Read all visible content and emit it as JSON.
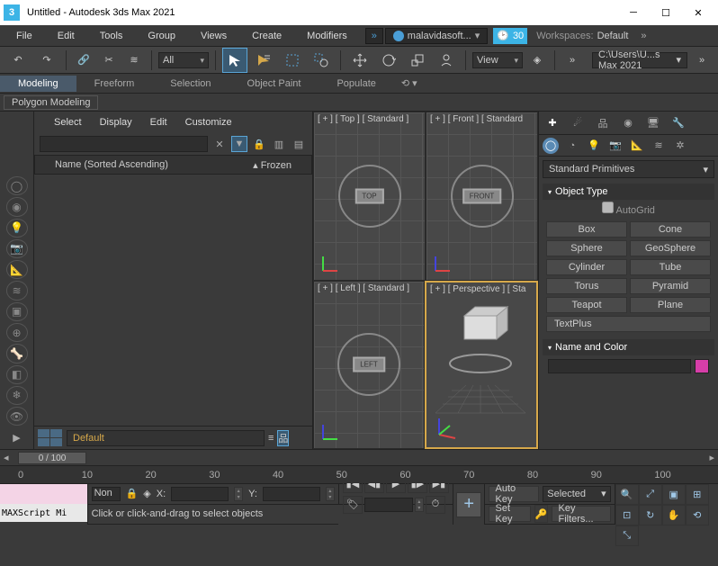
{
  "window": {
    "title": "Untitled - Autodesk 3ds Max 2021",
    "logo_text": "3"
  },
  "menu": {
    "items": [
      "File",
      "Edit",
      "Tools",
      "Group",
      "Views",
      "Create",
      "Modifiers"
    ],
    "signin": "malavidasoft...",
    "clock": "30",
    "workspaces_label": "Workspaces:",
    "workspaces_value": "Default"
  },
  "toolbar": {
    "selection_filter": "All",
    "view": "View",
    "path": "C:\\Users\\U...s Max 2021"
  },
  "ribbon": {
    "tabs": [
      "Modeling",
      "Freeform",
      "Selection",
      "Object Paint",
      "Populate"
    ],
    "sub": "Polygon Modeling"
  },
  "outliner": {
    "menu": [
      "Select",
      "Display",
      "Edit",
      "Customize"
    ],
    "header_name": "Name (Sorted Ascending)",
    "header_frozen": "▴ Frozen"
  },
  "viewports": {
    "top": {
      "label": "[ + ] [ Top ] [ Standard ]",
      "badge": "TOP"
    },
    "front": {
      "label": "[ + ] [ Front ] [ Standard",
      "badge": "FRONT"
    },
    "left": {
      "label": "[ + ] [ Left ] [ Standard ]",
      "badge": "LEFT"
    },
    "persp": {
      "label": "[ + ] [ Perspective ] [ Sta"
    }
  },
  "cmd": {
    "category": "Standard Primitives",
    "sec_obj": "Object Type",
    "autogrid": "AutoGrid",
    "buttons": [
      "Box",
      "Cone",
      "Sphere",
      "GeoSphere",
      "Cylinder",
      "Tube",
      "Torus",
      "Pyramid",
      "Teapot",
      "Plane",
      "TextPlus"
    ],
    "sec_name": "Name and Color"
  },
  "track": {
    "layer": "Default",
    "slider": "0 / 100",
    "ticks": [
      "0",
      "10",
      "20",
      "30",
      "40",
      "50",
      "60",
      "70",
      "80",
      "90",
      "100"
    ]
  },
  "status": {
    "script": "MAXScript Mi",
    "none_sel": "Non",
    "x": "X:",
    "y": "Y:",
    "z": "",
    "hint": "Click or click-and-drag to select objects",
    "autokey": "Auto Key",
    "setkey": "Set Key",
    "selected": "Selected",
    "keyfilters": "Key Filters..."
  }
}
